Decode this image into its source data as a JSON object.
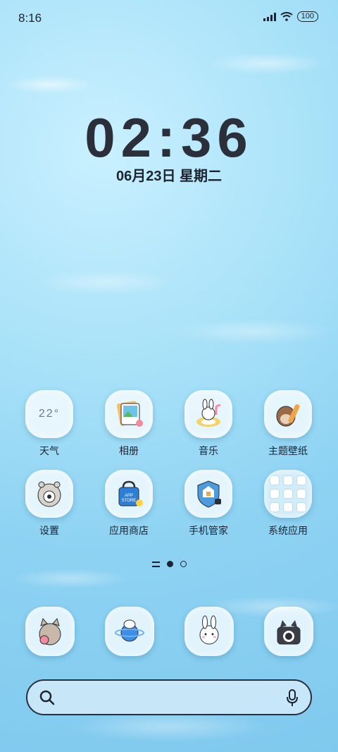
{
  "status_bar": {
    "time": "8:16",
    "battery": "100"
  },
  "clock": {
    "time": "02:36",
    "date": "06月23日 星期二"
  },
  "apps_row1": [
    {
      "label": "天气",
      "temp": "22°"
    },
    {
      "label": "相册"
    },
    {
      "label": "音乐"
    },
    {
      "label": "主题壁纸"
    }
  ],
  "apps_row2": [
    {
      "label": "设置"
    },
    {
      "label": "应用商店",
      "badge": "APP STORE"
    },
    {
      "label": "手机管家"
    },
    {
      "label": "系统应用"
    }
  ],
  "dock": [
    "phone-cat-icon",
    "planet-icon",
    "bunny-icon",
    "camera-cat-icon"
  ],
  "colors": {
    "text": "#1d2330",
    "clock": "#2a2f3a"
  }
}
